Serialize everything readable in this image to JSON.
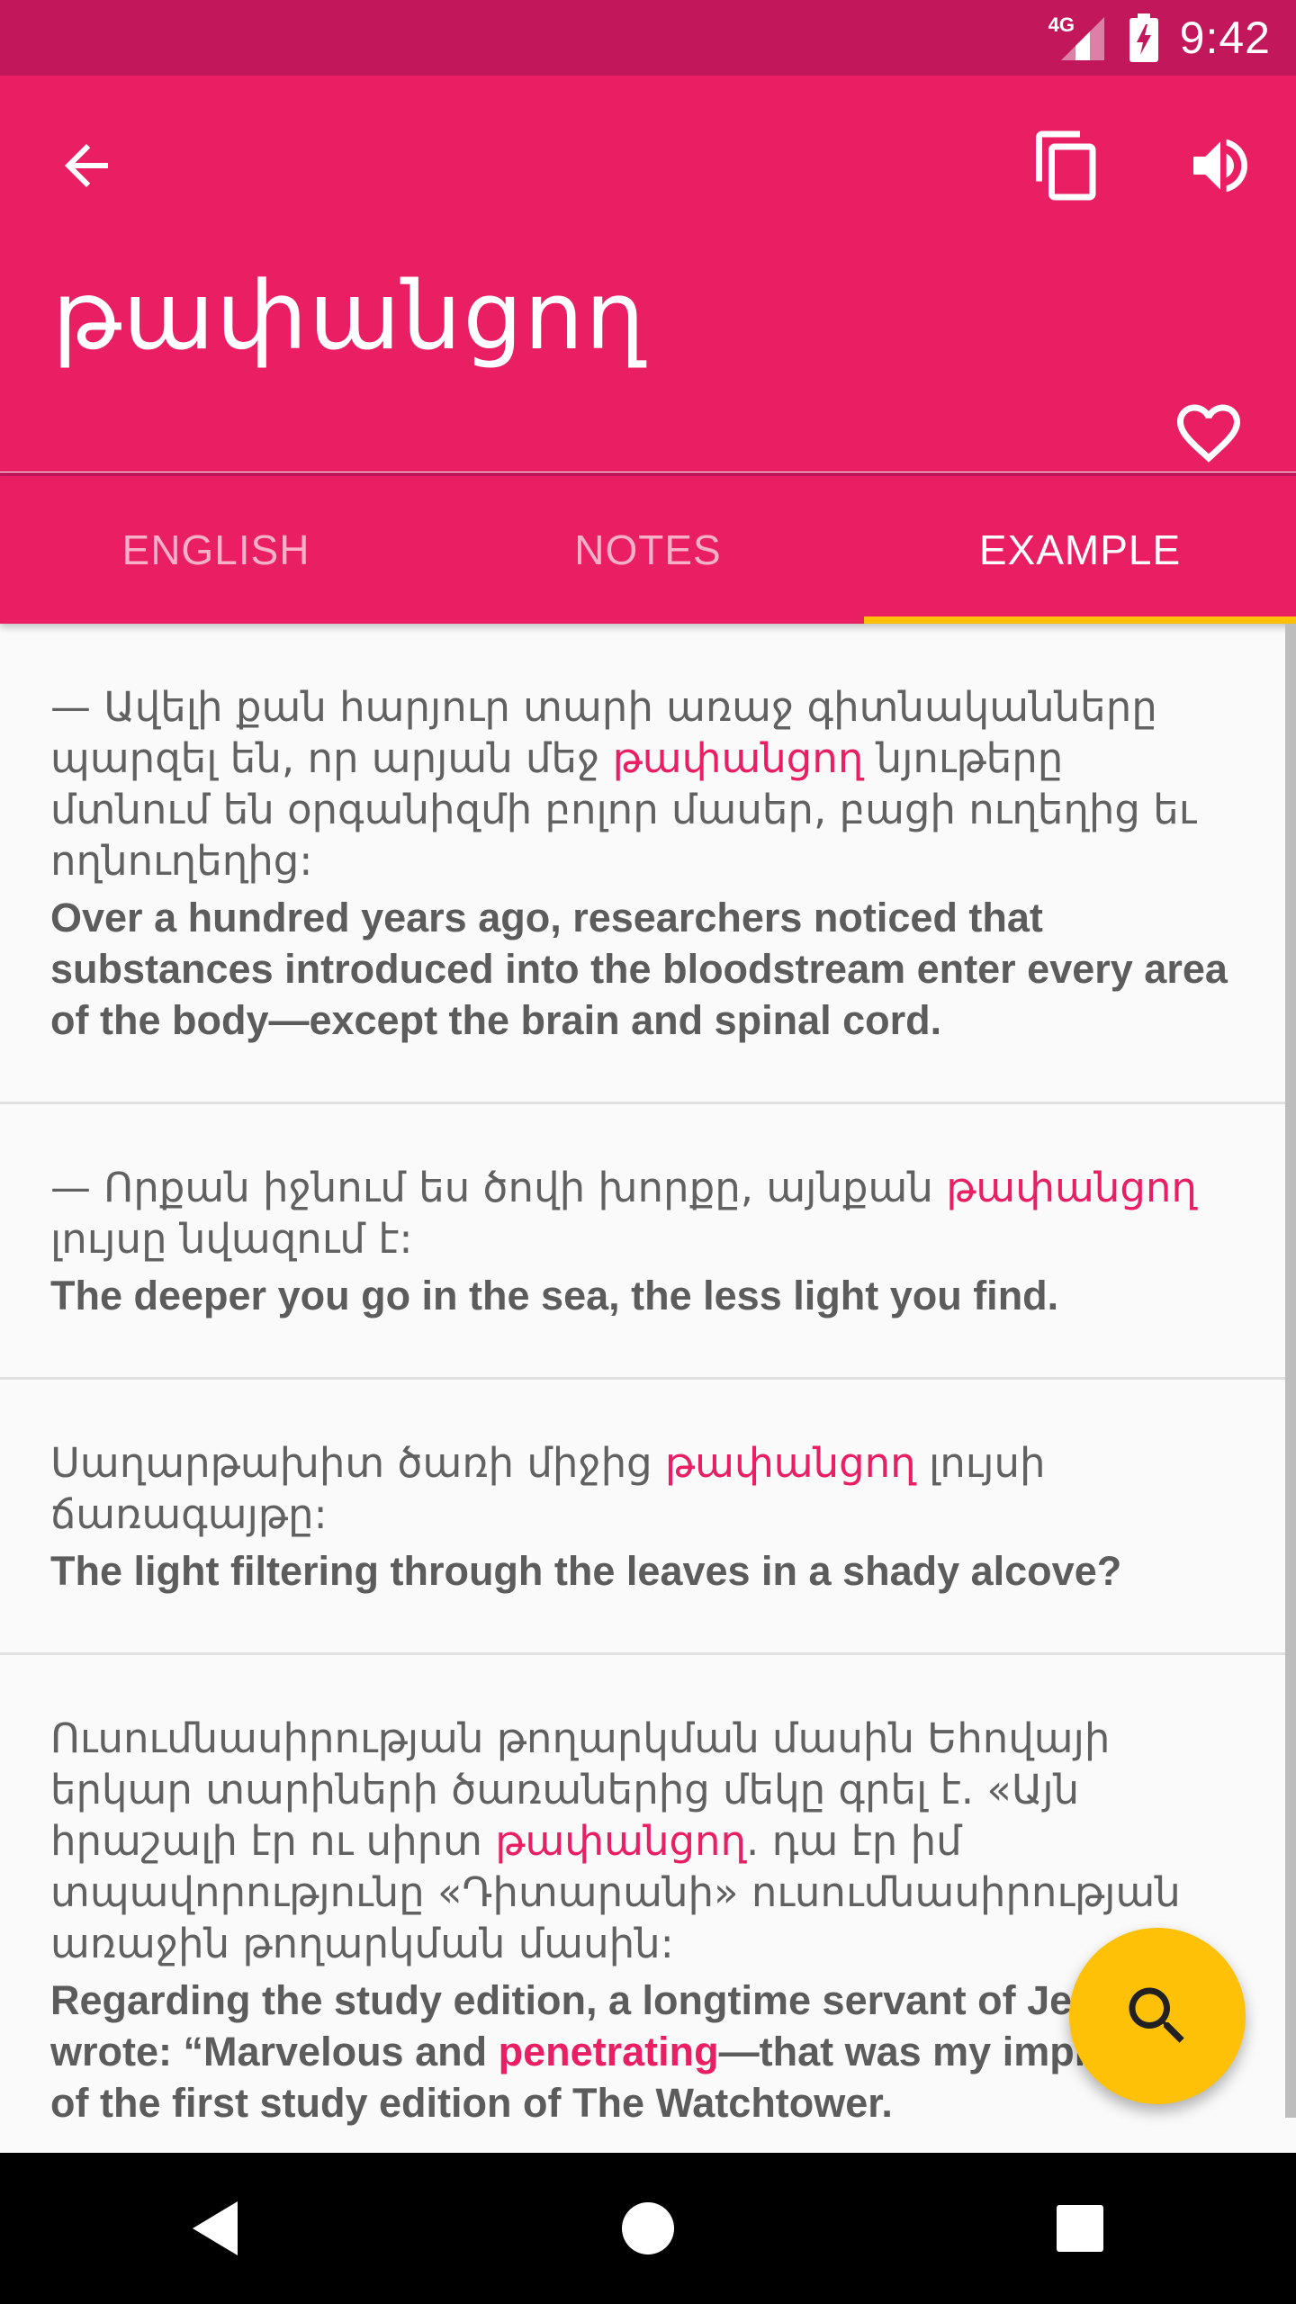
{
  "status_bar": {
    "network": "4G",
    "time": "9:42"
  },
  "app_bar": {
    "headword": "թափանցող",
    "icons": {
      "back": "arrow-back-icon",
      "copy": "copy-icon",
      "volume": "volume-up-icon",
      "favorite": "heart-outline-icon"
    }
  },
  "tabs": [
    {
      "label": "ENGLISH",
      "active": false
    },
    {
      "label": "NOTES",
      "active": false
    },
    {
      "label": "EXAMPLE",
      "active": true
    }
  ],
  "colors": {
    "primary": "#e91e63",
    "primary_dark": "#c2185b",
    "accent": "#ffc107"
  },
  "examples": [
    {
      "arm_before": "— Ավելի քան հարյուր տարի առաջ գիտնականները պարզել են, որ արյան մեջ ",
      "arm_highlight": "թափանցող",
      "arm_after": " նյութերը մտնում են օրգանիզմի բոլոր մասեր, բացի ուղեղից եւ ողնուղեղից:",
      "eng_before": "Over a hundred years ago, researchers noticed that substances introduced into the bloodstream enter every area of the body—except the brain and spinal cord.",
      "eng_highlight": "",
      "eng_after": ""
    },
    {
      "arm_before": "— Որքան իջնում ես ծովի խորքը, այնքան ",
      "arm_highlight": "թափանցող",
      "arm_after": " լույսը նվազում է:",
      "eng_before": "The deeper you go in the sea, the less light you find.",
      "eng_highlight": "",
      "eng_after": ""
    },
    {
      "arm_before": "Սաղարթախիտ ծառի միջից ",
      "arm_highlight": "թափանցող",
      "arm_after": " լույսի ճառագայթը:",
      "eng_before": "The light filtering through the leaves in a shady alcove?",
      "eng_highlight": "",
      "eng_after": ""
    },
    {
      "arm_before": "Ուսումնասիրության թողարկման մասին Եհովայի երկար տարիների ծառաներից մեկը գրել է. «Այն հրաշալի էր ու սիրտ ",
      "arm_highlight": "թափանցող",
      "arm_after": ". դա էր իմ տպավորությունը «Դիտարանի» ուսումնասիրության առաջին թողարկման մասին:",
      "eng_before": "Regarding the study edition, a longtime servant of Jehovah wrote: “Marvelous and ",
      "eng_highlight": "penetrating",
      "eng_after": "—that was my impression of the first study edition of The Watchtower."
    }
  ],
  "fab": {
    "icon": "search-icon"
  },
  "nav_bar": {
    "icons": [
      "back-triangle-icon",
      "home-circle-icon",
      "recents-square-icon"
    ]
  }
}
